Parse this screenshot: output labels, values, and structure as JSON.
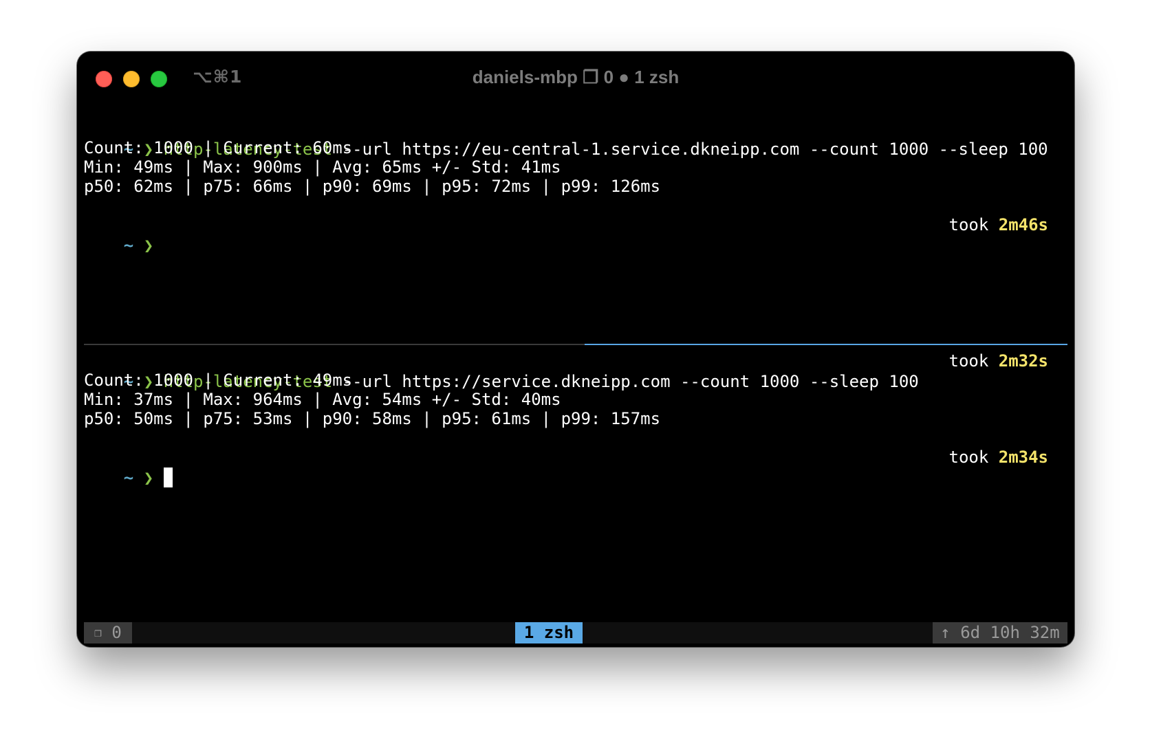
{
  "window": {
    "shortcut": "⌥⌘1",
    "title": "daniels-mbp ❐ 0 ● 1 zsh"
  },
  "pane_top": {
    "prompt_tilde": "~",
    "prompt_chevron": "❯",
    "command": "http-latency-test",
    "args": " --url https://eu-central-1.service.dkneipp.com --count 1000 --sleep 100",
    "output": [
      "Count: 1000 | Current: 60ms",
      "Min: 49ms | Max: 900ms | Avg: 65ms +/- Std: 41ms",
      "p50: 62ms | p75: 66ms | p90: 69ms | p95: 72ms | p99: 126ms"
    ],
    "second_prompt_tilde": "~",
    "second_prompt_chevron": "❯",
    "took_label": "took ",
    "took_value": "2m46s"
  },
  "pane_bottom": {
    "prompt_tilde": "~",
    "prompt_chevron": "❯",
    "command": "http-latency-test",
    "args": " --url https://service.dkneipp.com --count 1000 --sleep 100",
    "took_label": "took ",
    "took_value": "2m32s",
    "output": [
      "Count: 1000 | Current: 49ms",
      "Min: 37ms | Max: 964ms | Avg: 54ms +/- Std: 40ms",
      "p50: 50ms | p75: 53ms | p90: 58ms | p95: 61ms | p99: 157ms"
    ],
    "second_prompt_tilde": "~",
    "second_prompt_chevron": "❯",
    "second_took_label": "took ",
    "second_took_value": "2m34s"
  },
  "statusbar": {
    "left_icon": "❐",
    "left_text": " 0",
    "middle_text": "1 zsh",
    "right_text": "↑ 6d 10h 32m"
  },
  "colors": {
    "background": "#000000",
    "prompt_green": "#8bc34a",
    "prompt_blue": "#5fa8c8",
    "took_yellow": "#f4e36a",
    "active_pane_border": "#58a6e6",
    "status_active": "#5aa9e6"
  }
}
